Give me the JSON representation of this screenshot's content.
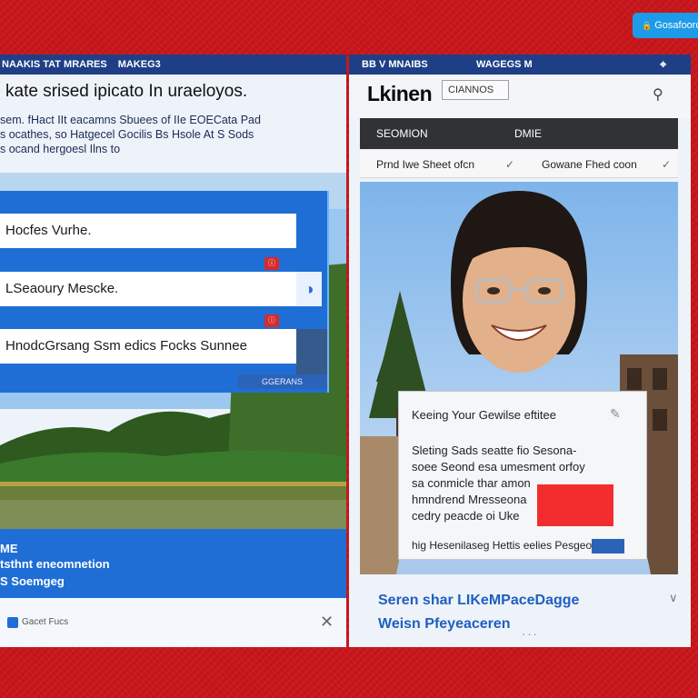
{
  "top_pill": {
    "icon": "🔒",
    "label": "Gosafooro",
    "color": "#1e9be8"
  },
  "left": {
    "bar_items": [
      "NAAKIS TAT MRARES",
      "MAKEG3"
    ],
    "headline": "kate srised ipicato In uraeloyos.",
    "description": "sem. fHact IIt eacamns Sbuees of IIe EOECata Pad\ns ocathes, so Hatgecel Gocilis Bs Hsole At S Sods\ns ocand hergoesl Ilns to",
    "form_rows": [
      "Hocfes Vurhe.",
      "LSeaoury Mescke.",
      "HnodcGrsang Ssm edics Focks Sunnee"
    ],
    "form_footer": "GGERANS",
    "lower_lines": [
      "ME",
      "tsthnt eneomnetion",
      "S Soemgeg"
    ],
    "footer_text": "Gacet Fucs",
    "brand_color": "#1f6ed6"
  },
  "right": {
    "bar_items": [
      "BB V MNAIBS",
      "WAGEGS M"
    ],
    "brand": "Lkinen",
    "brand_box": "CIANNOS",
    "dark_bar": [
      "SEOMION",
      "DMIE"
    ],
    "filters": [
      "Prnd Iwe Sheet ofcn",
      "Gowane Fhed coon"
    ],
    "card": {
      "title": "Keeing Your Gewilse eftitee",
      "body": "Sleting Sads seatte fio Sesona-\nsoee Seond esa umesment orfoy\nsa conmicle thar amon\nhmndrend Mresseona\ncedry peacde oi Uke",
      "footer": "hig Hesenilaseg Hettis eelies Pesgeo"
    },
    "footer_lines": [
      "Seren shar LIKeMPaceDagge",
      "Weisn Pfeyeaceren"
    ],
    "accent": "#f32d2d"
  }
}
